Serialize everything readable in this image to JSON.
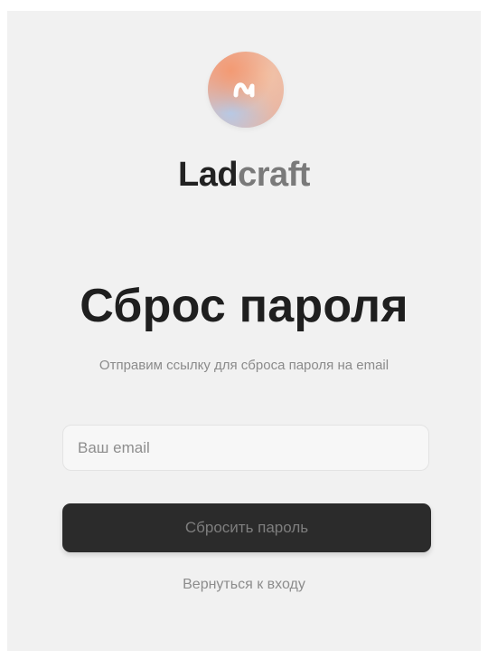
{
  "brand": {
    "name_part1": "Lad",
    "name_part2": "craft",
    "logo_icon": "wave-icon",
    "colors": {
      "dark": "#222222",
      "light": "#7a7a7a"
    }
  },
  "page": {
    "title": "Сброс пароля",
    "subtitle": "Отправим ссылку для сброса пароля на email"
  },
  "form": {
    "email": {
      "value": "",
      "placeholder": "Ваш email"
    },
    "submit_label": "Сбросить пароль",
    "back_label": "Вернуться к входу"
  },
  "colors": {
    "background": "#f1f1f1",
    "button_bg": "#2b2b2b",
    "button_text": "#7e7e7e",
    "muted_text": "#8b8b8b"
  }
}
